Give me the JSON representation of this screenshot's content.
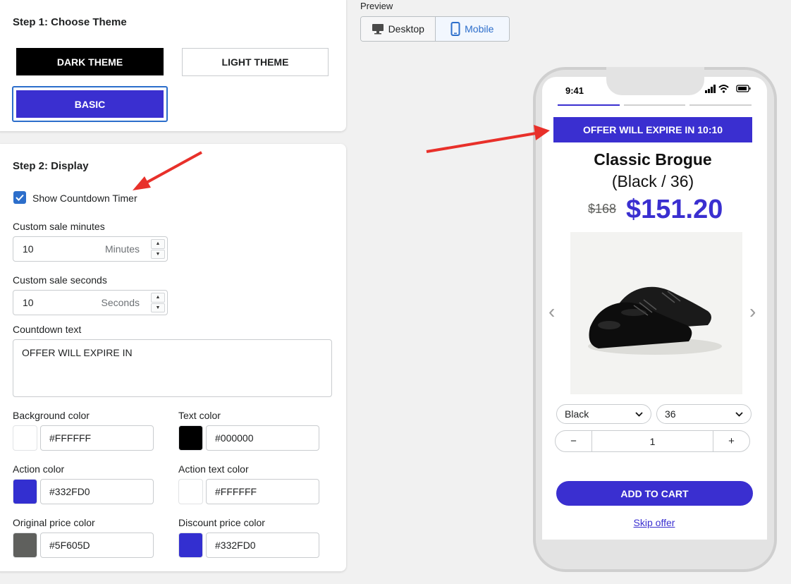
{
  "step1": {
    "title": "Step 1: Choose Theme",
    "dark_theme": "DARK THEME",
    "light_theme": "LIGHT THEME",
    "basic_theme": "BASIC"
  },
  "step2": {
    "title": "Step 2: Display",
    "show_countdown_label": "Show Countdown Timer",
    "show_countdown_checked": true,
    "minutes_label": "Custom sale minutes",
    "minutes_value": "10",
    "minutes_suffix": "Minutes",
    "seconds_label": "Custom sale seconds",
    "seconds_value": "10",
    "seconds_suffix": "Seconds",
    "countdown_text_label": "Countdown text",
    "countdown_text_value": "OFFER WILL EXPIRE IN",
    "colors": {
      "background_label": "Background color",
      "background_value": "#FFFFFF",
      "text_label": "Text color",
      "text_value": "#000000",
      "action_label": "Action color",
      "action_value": "#332FD0",
      "action_text_label": "Action text color",
      "action_text_value": "#FFFFFF",
      "original_price_label": "Original price color",
      "original_price_value": "#5F605D",
      "discount_price_label": "Discount price color",
      "discount_price_value": "#332FD0"
    }
  },
  "preview": {
    "label": "Preview",
    "desktop": "Desktop",
    "mobile": "Mobile",
    "selected": "Mobile"
  },
  "phone": {
    "time": "9:41",
    "offer_banner": "OFFER WILL EXPIRE IN 10:10",
    "product_title": "Classic Brogue",
    "product_variant": "(Black / 36)",
    "original_price": "$168",
    "sale_price": "$151.20",
    "color_option": "Black",
    "size_option": "36",
    "quantity": "1",
    "qty_minus": "−",
    "qty_plus": "+",
    "add_to_cart": "ADD TO CART",
    "skip_offer": "Skip offer"
  },
  "colors": {
    "accent": "#332FD0",
    "link_blue": "#2C6ECB",
    "annotation_red": "#E8302A"
  }
}
